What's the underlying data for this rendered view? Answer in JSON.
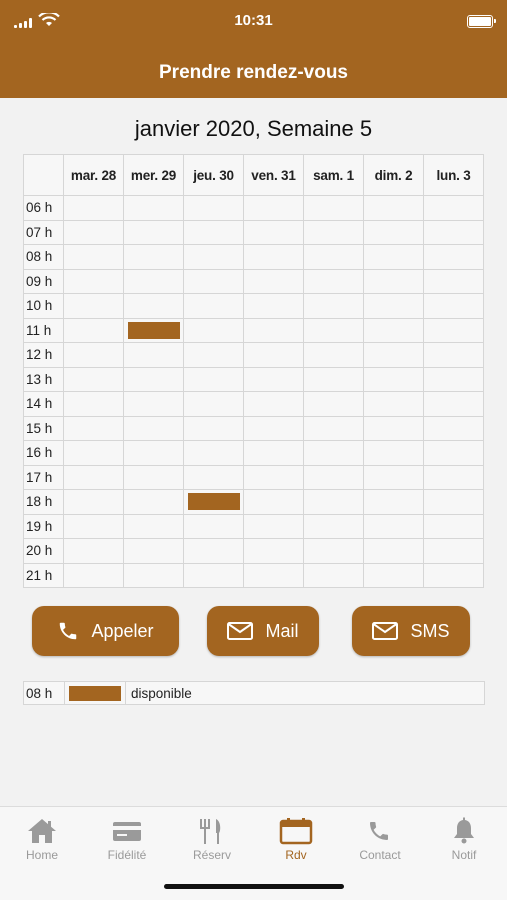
{
  "status_bar": {
    "time": "10:31"
  },
  "nav": {
    "title": "Prendre rendez-vous"
  },
  "calendar": {
    "week_title": "janvier 2020, Semaine 5",
    "days": [
      "mar. 28",
      "mer. 29",
      "jeu. 30",
      "ven. 31",
      "sam. 1",
      "dim. 2",
      "lun. 3"
    ],
    "hours": [
      "06 h",
      "07 h",
      "08 h",
      "09 h",
      "10 h",
      "11 h",
      "12 h",
      "13 h",
      "14 h",
      "15 h",
      "16 h",
      "17 h",
      "18 h",
      "19 h",
      "20 h",
      "21 h"
    ],
    "booked_slots": [
      {
        "day": "mer. 29",
        "hour": "11 h"
      },
      {
        "day": "jeu. 30",
        "hour": "18 h"
      }
    ]
  },
  "actions": {
    "call_label": "Appeler",
    "mail_label": "Mail",
    "sms_label": "SMS"
  },
  "legend": {
    "hour": "08 h",
    "text": "disponible"
  },
  "tabbar": {
    "items": [
      {
        "label": "Home",
        "icon": "home-icon"
      },
      {
        "label": "Fidélité",
        "icon": "card-icon"
      },
      {
        "label": "Réserv",
        "icon": "cutlery-icon"
      },
      {
        "label": "Rdv",
        "icon": "calendar-icon",
        "active": true
      },
      {
        "label": "Contact",
        "icon": "phone-icon"
      },
      {
        "label": "Notif",
        "icon": "bell-icon"
      }
    ]
  },
  "colors": {
    "accent": "#a36520",
    "tab_inactive": "#9a9a9a",
    "background": "#f2f2f2"
  }
}
